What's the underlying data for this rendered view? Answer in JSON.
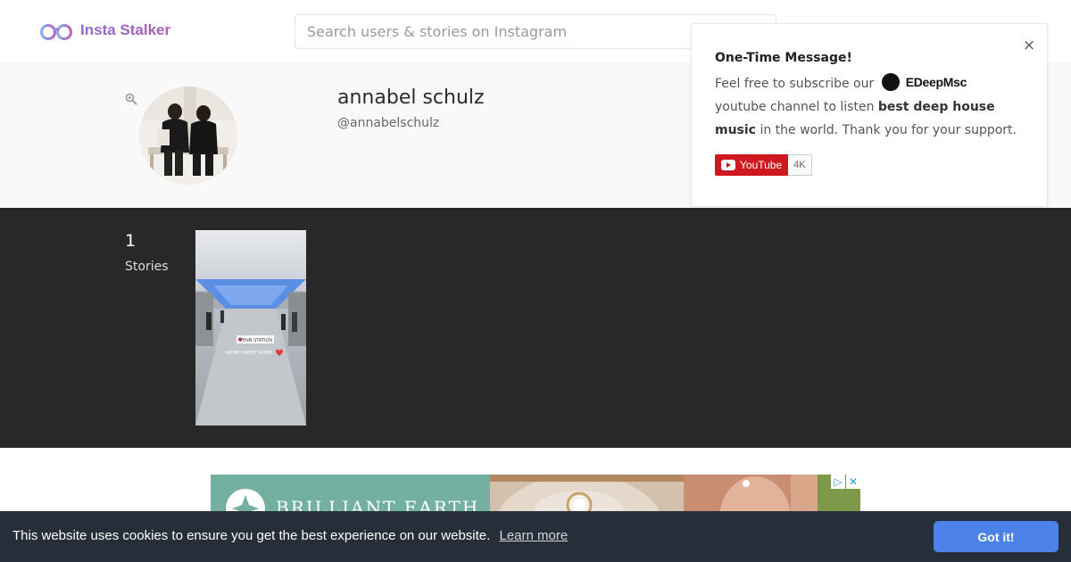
{
  "header": {
    "brand": "Insta Stalker",
    "search_placeholder": "Search users & stories on Instagram"
  },
  "profile": {
    "full_name": "annabel schulz",
    "username": "@annabelschulz"
  },
  "stories": {
    "count": "1",
    "label": "Stories",
    "thumb_tag": "PENN STATION",
    "thumb_caption": "HOME SWEET HOME"
  },
  "ad": {
    "brand": "BRILLIANT EARTH"
  },
  "cookie": {
    "message": "This website uses cookies to ensure you get the best experience on our website.",
    "link": "Learn more",
    "button": "Got it!"
  },
  "popup": {
    "title": "One-Time Message!",
    "text_1": "Feel free to subscribe our",
    "brand": "EDeepMsc",
    "text_2": "youtube channel to listen",
    "bold": "best deep house music",
    "text_3": "in the world. Thank you for your support.",
    "yt_label": "YouTube",
    "yt_count": "4K",
    "close": "×"
  },
  "colors": {
    "brand_gradient": [
      "#7e8cf0",
      "#c45ab8"
    ],
    "stories_bg": "#282828",
    "cookie_bg": "#252e39",
    "cookie_button": "#4b81e8",
    "youtube_red": "#cc181e"
  },
  "icons": [
    "logo-glasses-icon",
    "zoom-icon",
    "close-icon",
    "youtube-play-icon",
    "ad-choices-icon",
    "ad-close-icon"
  ]
}
